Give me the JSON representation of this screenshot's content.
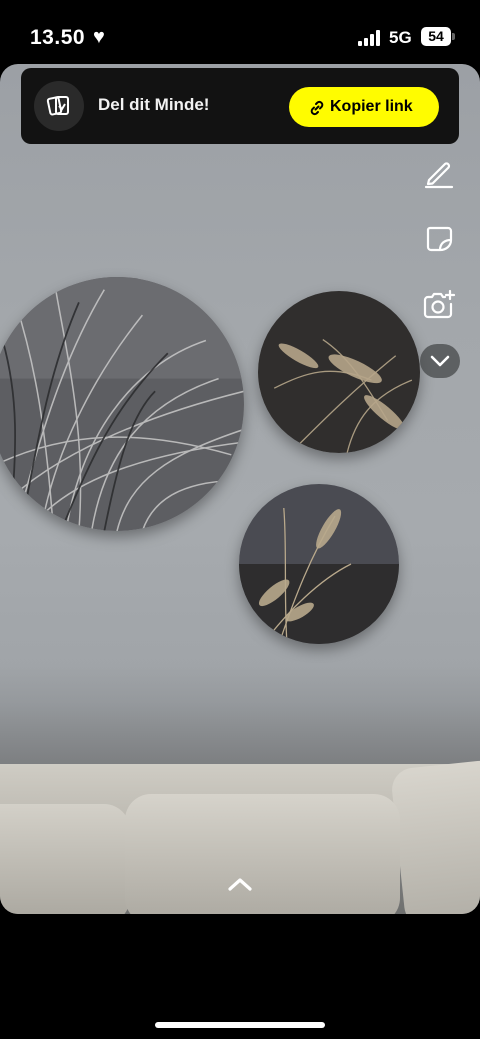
{
  "status_bar": {
    "time": "13.50",
    "network": "5G",
    "battery": "54",
    "icons": [
      "heart-icon",
      "signal-icon",
      "battery-icon"
    ]
  },
  "share_banner": {
    "text": "Del dit Minde!",
    "button_label": "Kopier link",
    "button_color": "#fffc00",
    "icons": [
      "memories-icon",
      "link-icon"
    ]
  },
  "tools": [
    "pencil-icon",
    "sticker-icon",
    "camera-plus-icon",
    "chevron-down-icon"
  ],
  "bottom": {
    "icon": "chevron-up-icon"
  }
}
